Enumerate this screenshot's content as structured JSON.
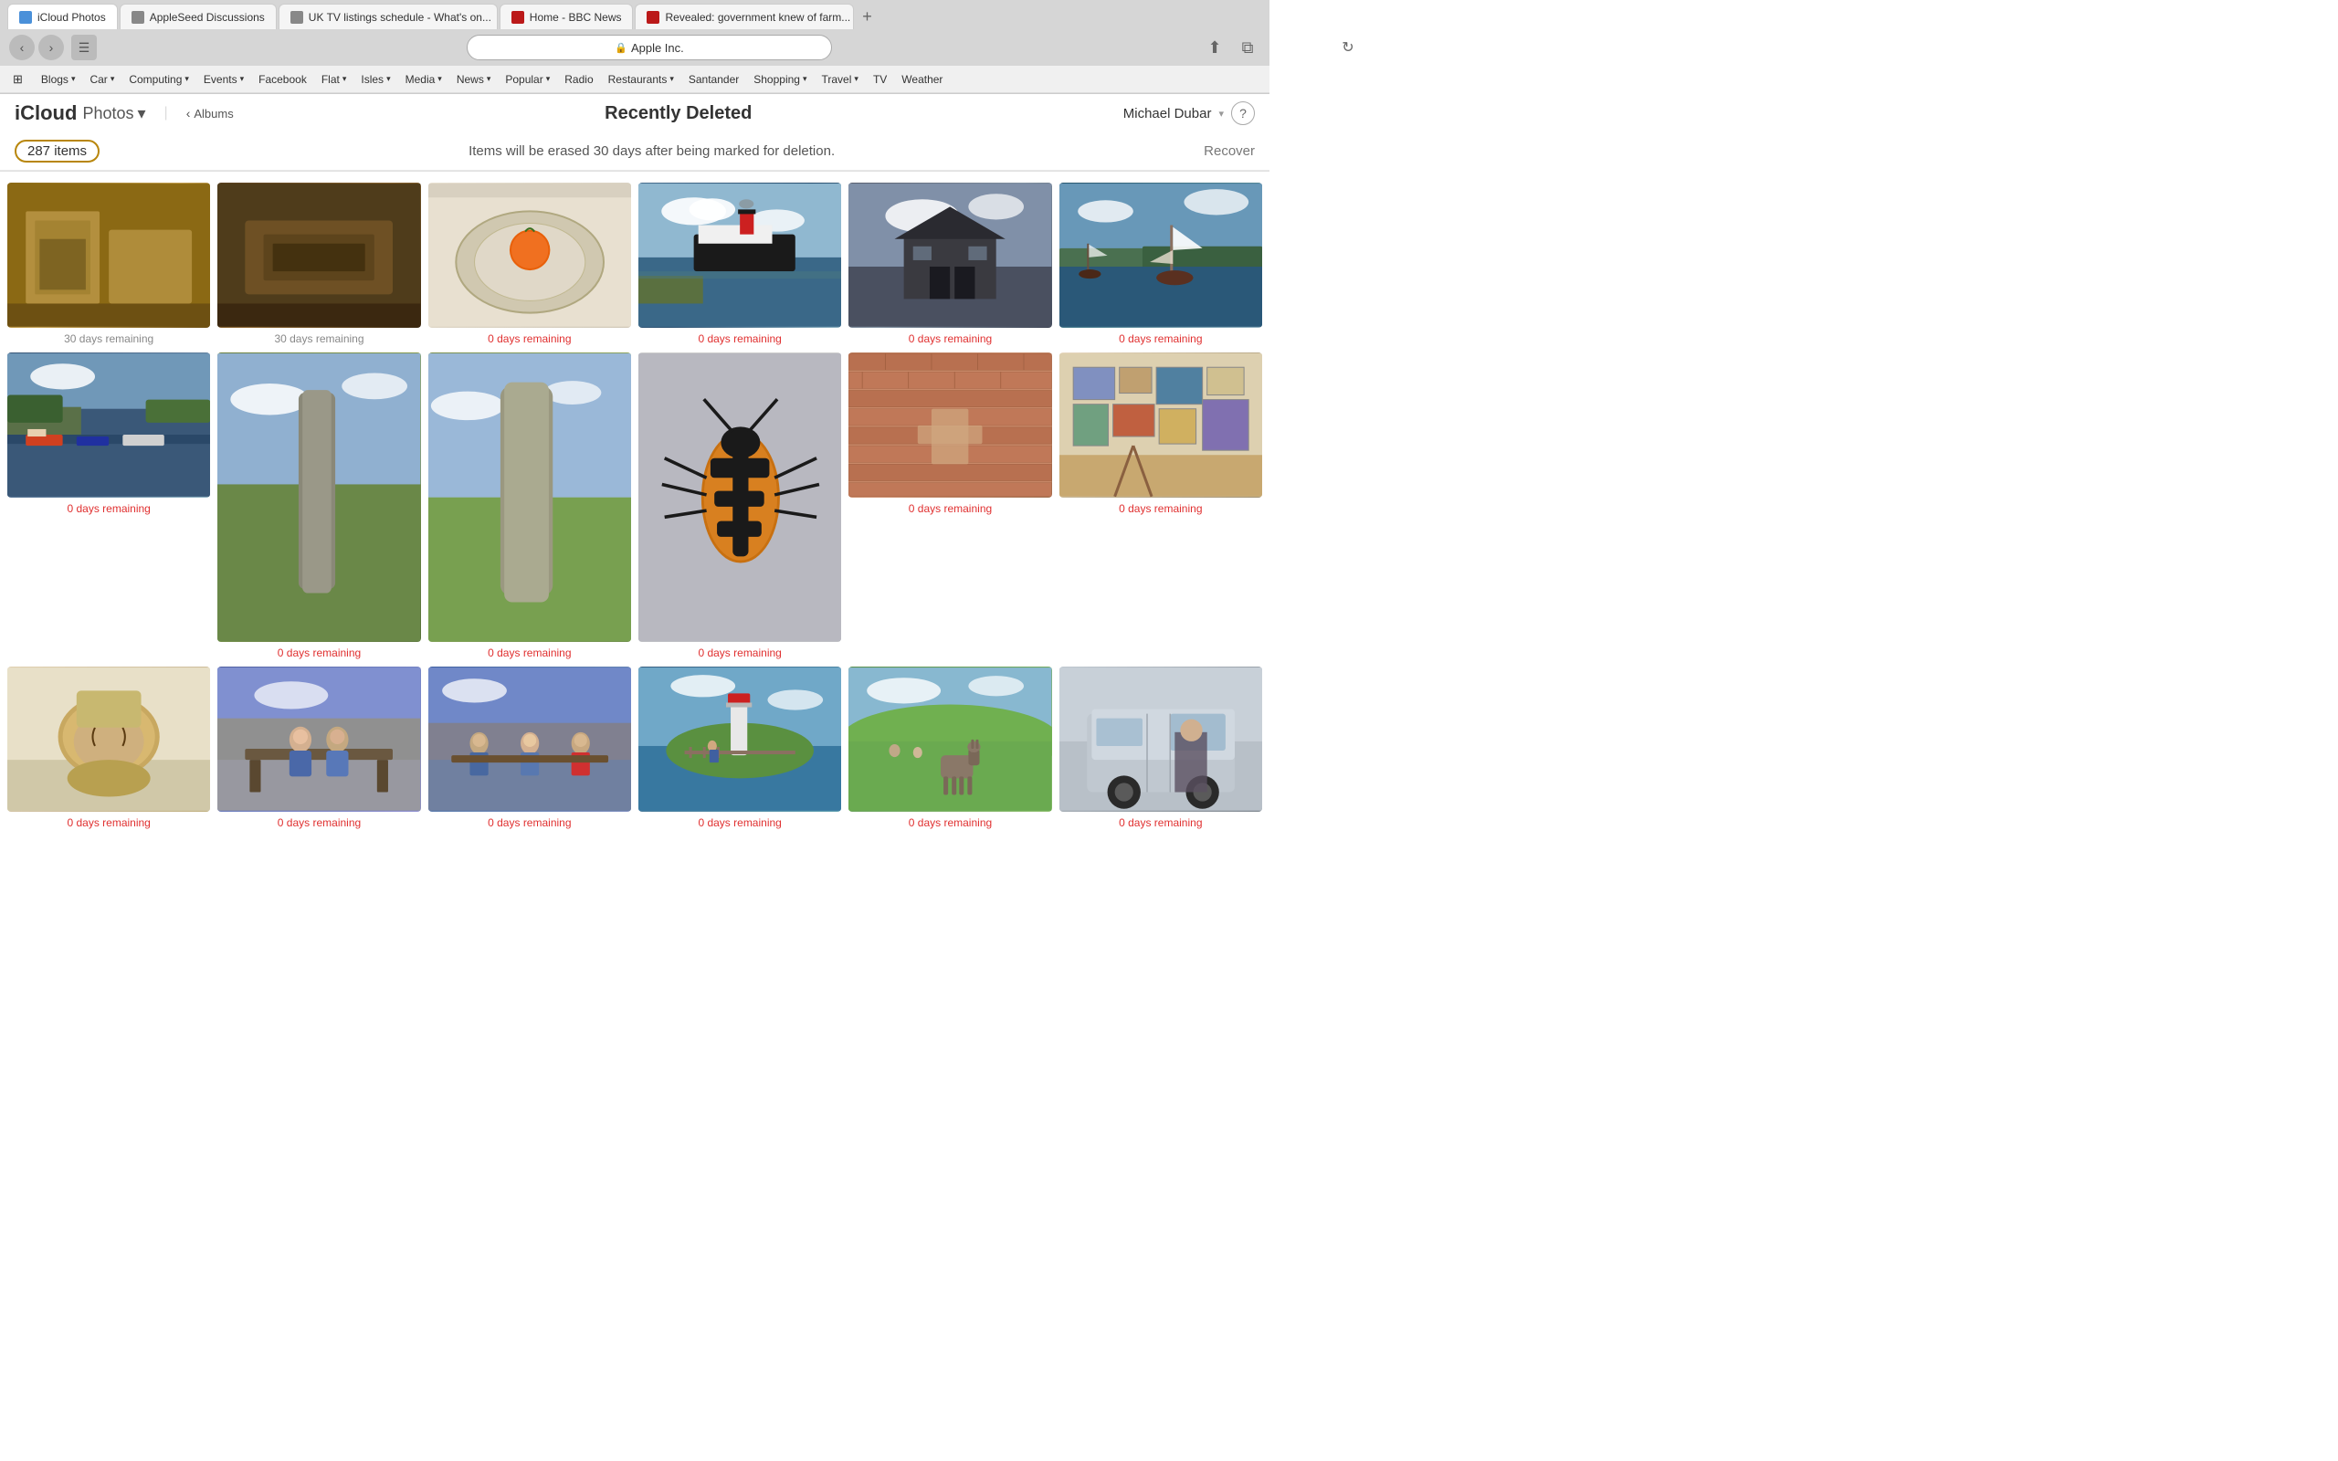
{
  "browser": {
    "back_label": "‹",
    "forward_label": "›",
    "sidebar_label": "⊞",
    "address": "Apple Inc.",
    "lock_icon": "🔒",
    "reload_label": "↻",
    "share_label": "⬆",
    "newwindow_label": "⧉",
    "new_tab_label": "+"
  },
  "bookmarks": {
    "grid_icon": "⊞",
    "items": [
      {
        "label": "Blogs",
        "has_arrow": true
      },
      {
        "label": "Car",
        "has_arrow": true
      },
      {
        "label": "Computing",
        "has_arrow": true
      },
      {
        "label": "Events",
        "has_arrow": true
      },
      {
        "label": "Facebook",
        "has_arrow": false
      },
      {
        "label": "Flat",
        "has_arrow": true
      },
      {
        "label": "Isles",
        "has_arrow": true
      },
      {
        "label": "Media",
        "has_arrow": true
      },
      {
        "label": "News",
        "has_arrow": true
      },
      {
        "label": "Popular",
        "has_arrow": true
      },
      {
        "label": "Radio",
        "has_arrow": false
      },
      {
        "label": "Restaurants",
        "has_arrow": true
      },
      {
        "label": "Santander",
        "has_arrow": false
      },
      {
        "label": "Shopping",
        "has_arrow": true
      },
      {
        "label": "Travel",
        "has_arrow": true
      },
      {
        "label": "TV",
        "has_arrow": false
      },
      {
        "label": "Weather",
        "has_arrow": false
      }
    ]
  },
  "tabs": [
    {
      "label": "iCloud Photos",
      "active": true,
      "favicon_class": "cloud"
    },
    {
      "label": "AppleSeed Discussions",
      "active": false,
      "favicon_class": "apple"
    },
    {
      "label": "UK TV listings schedule - What's on...",
      "active": false,
      "favicon_class": "apple"
    },
    {
      "label": "Home - BBC News",
      "active": false,
      "favicon_class": "bbc"
    },
    {
      "label": "Revealed: government knew of farm...",
      "active": false,
      "favicon_class": "bbc"
    }
  ],
  "header": {
    "icloud_label": "iCloud",
    "photos_label": "Photos",
    "photos_chevron": "▾",
    "back_chevron": "‹",
    "albums_label": "Albums",
    "page_title": "Recently Deleted",
    "user_name": "Michael Dubar",
    "user_chevron": "▾",
    "help_label": "?"
  },
  "content": {
    "item_count": "287 items",
    "notice": "Items will be erased 30 days after being marked for deletion.",
    "recover_label": "Recover",
    "photos": [
      {
        "color_class": "ph-museum",
        "label": "30 days remaining",
        "label_class": "gray"
      },
      {
        "color_class": "ph-typewriter",
        "label": "30 days remaining",
        "label_class": "gray"
      },
      {
        "color_class": "ph-orange",
        "label": "0 days remaining",
        "label_class": "red"
      },
      {
        "color_class": "ph-ship",
        "label": "0 days remaining",
        "label_class": "red"
      },
      {
        "color_class": "ph-barn",
        "label": "0 days remaining",
        "label_class": "red"
      },
      {
        "color_class": "ph-sailboat",
        "label": "0 days remaining",
        "label_class": "red"
      },
      {
        "color_class": "ph-harbor",
        "label": "0 days remaining",
        "label_class": "red"
      },
      {
        "color_class": "ph-stone",
        "label": "0 days remaining",
        "label_class": "red"
      },
      {
        "color_class": "ph-standing-stone",
        "label": "0 days remaining",
        "label_class": "red"
      },
      {
        "color_class": "ph-beetle",
        "label": "0 days remaining",
        "label_class": "red"
      },
      {
        "color_class": "ph-redwall",
        "label": "0 days remaining",
        "label_class": "red"
      },
      {
        "color_class": "ph-gallery",
        "label": "0 days remaining",
        "label_class": "red"
      },
      {
        "color_class": "ph-toilet",
        "label": "0 days remaining",
        "label_class": "red"
      },
      {
        "color_class": "ph-bench",
        "label": "0 days remaining",
        "label_class": "red"
      },
      {
        "color_class": "ph-sisters",
        "label": "0 days remaining",
        "label_class": "red"
      },
      {
        "color_class": "ph-lighthouse",
        "label": "0 days remaining",
        "label_class": "red"
      },
      {
        "color_class": "ph-hillside",
        "label": "0 days remaining",
        "label_class": "red"
      },
      {
        "color_class": "ph-van",
        "label": "0 days remaining",
        "label_class": "red"
      }
    ]
  }
}
